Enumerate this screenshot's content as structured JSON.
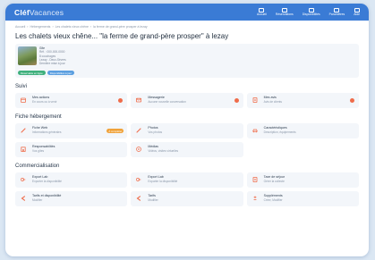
{
  "app": {
    "logo_main": "Cléf",
    "logo_sub": "Vacances"
  },
  "nav": [
    {
      "label": "Accueil"
    },
    {
      "label": "Réservations"
    },
    {
      "label": "Disponibilités"
    },
    {
      "label": "Paramètres"
    },
    {
      "label": "Aide"
    }
  ],
  "breadcrumb": [
    "Accueil",
    "Hébergements",
    "Les chalets vieux chêne",
    "la ferme de grand-père prosper à lezay"
  ],
  "page": {
    "title": "Les chalets vieux chêne... \"la ferme de grand-père prosper\" à lezay"
  },
  "property": {
    "name": "Gîte",
    "lines": [
      "Réf. : 000-000-0000",
      "8 couchages",
      "Lezay - Deux-Sèvres",
      "Dernière mise à jour"
    ],
    "badges": [
      "Réservable en ligne",
      "Disponibilités à jour"
    ]
  },
  "sections": {
    "suivi": {
      "title": "Suivi",
      "tiles": [
        {
          "title": "Mes actions",
          "sub": "En cours ou à venir",
          "icon": "calendar-icon",
          "marker": "dot"
        },
        {
          "title": "Messagerie",
          "sub": "Aucune nouvelle conversation",
          "icon": "mail-icon",
          "marker": "dot"
        },
        {
          "title": "Mes avis",
          "sub": "Avis de clients",
          "icon": "document-icon",
          "marker": "dot"
        }
      ]
    },
    "fiche": {
      "title": "Fiche hébergement",
      "tiles": [
        {
          "title": "Fiche Web",
          "sub": "Informations générales",
          "icon": "pencil-icon",
          "marker": "pill",
          "pill": "À compléter"
        },
        {
          "title": "Photos",
          "sub": "Vos photos",
          "icon": "pencil-icon",
          "marker": "none"
        },
        {
          "title": "Caractéristiques",
          "sub": "Description, équipements",
          "icon": "car-icon",
          "marker": "none"
        },
        {
          "title": "Responsabilités",
          "sub": "Vos gîtes",
          "icon": "building-icon",
          "marker": "none"
        },
        {
          "title": "Médias",
          "sub": "Vidéos, visites virtuelles",
          "icon": "play-icon",
          "marker": "none"
        }
      ]
    },
    "commercialisation": {
      "title": "Commercialisation",
      "tiles": [
        {
          "title": "Export Lab",
          "sub": "Exporter la disponibilité",
          "icon": "link-icon",
          "marker": "none"
        },
        {
          "title": "Export Lab",
          "sub": "Exporter la disponibilité",
          "icon": "link-icon",
          "marker": "none"
        },
        {
          "title": "Taxe de séjour",
          "sub": "Gérer la collecte",
          "icon": "document-icon",
          "marker": "none"
        },
        {
          "title": "Tarifs et disponibilité",
          "sub": "Modifier",
          "icon": "arrow-left-icon",
          "marker": "none"
        },
        {
          "title": "Tarifs",
          "sub": "Modifier",
          "icon": "arrow-left-icon",
          "marker": "none"
        },
        {
          "title": "Suppléments",
          "sub": "Créer, Modifier",
          "icon": "plus-minus-icon",
          "marker": "none"
        }
      ]
    }
  },
  "colors": {
    "brand": "#3a7bd5",
    "accent": "#ef6c4a",
    "warning": "#f0a23a",
    "success": "#3fb07d"
  }
}
